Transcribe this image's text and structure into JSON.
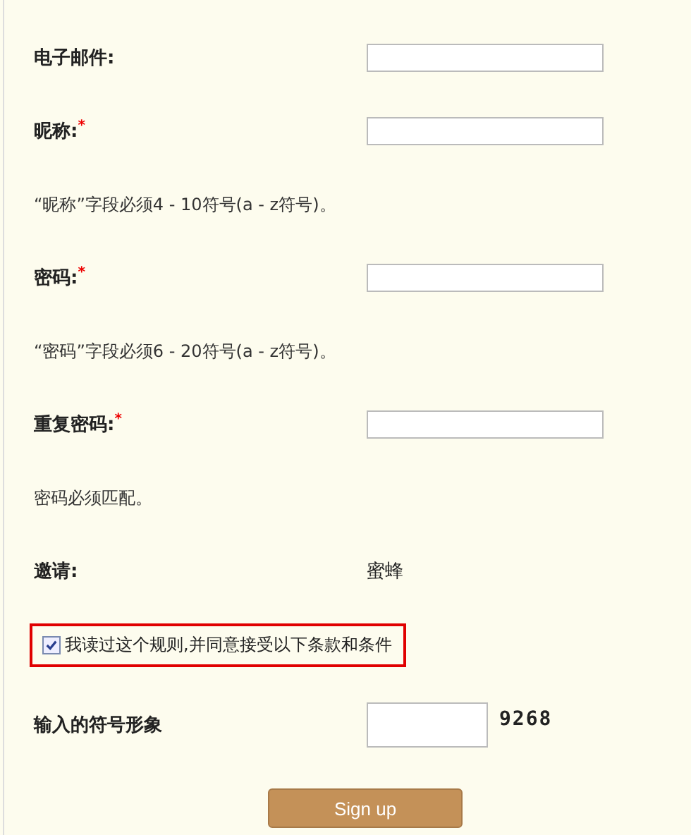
{
  "rows": [
    {
      "kind": "field",
      "label": "电子邮件:"
    },
    {
      "kind": "field",
      "label": "昵称:",
      "required_mark": "*"
    },
    {
      "kind": "hint",
      "text": "“昵称”字段必须4 - 10符号(a - z符号)。"
    },
    {
      "kind": "field",
      "label": "密码:",
      "required_mark": "*"
    },
    {
      "kind": "hint",
      "text": "“密码”字段必须6 - 20符号(a - z符号)。"
    },
    {
      "kind": "field",
      "label": "重复密码:",
      "required_mark": "*"
    },
    {
      "kind": "hint",
      "text": "密码必须匹配。"
    },
    {
      "kind": "invite",
      "label": "邀请:",
      "value": "蜜蜂"
    }
  ],
  "agree": {
    "label": "我读过这个规则,并同意接受以下条款和条件",
    "checked": true,
    "highlighted": true
  },
  "captcha": {
    "label": "输入的符号形象",
    "code": "9268"
  },
  "button": "Sign up"
}
